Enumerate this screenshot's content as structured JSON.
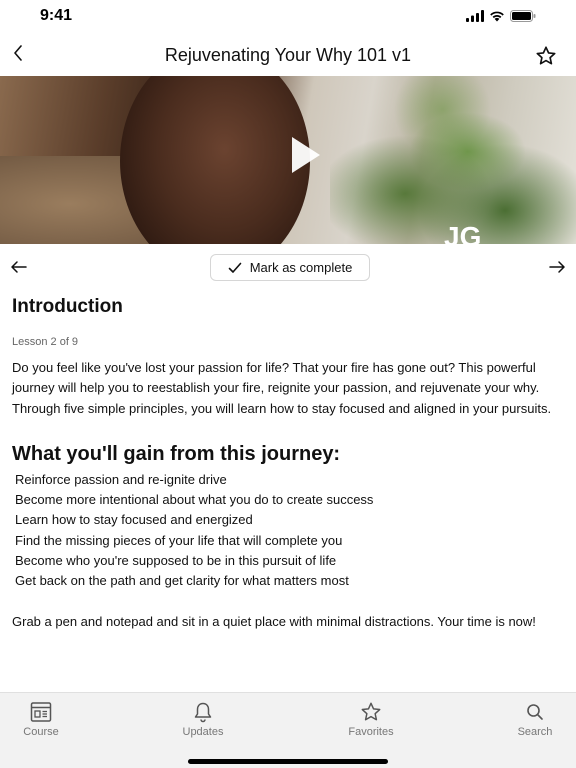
{
  "status_bar": {
    "time": "9:41"
  },
  "nav": {
    "title": "Rejuvenating Your Why 101 v1",
    "back_icon": "chevron-left-icon",
    "favorite_icon": "star-outline-icon"
  },
  "hero": {
    "logo_text": "JG",
    "play_icon": "play-icon"
  },
  "lesson_nav": {
    "mark_complete_label": "Mark as complete",
    "prev_icon": "arrow-left-icon",
    "next_icon": "arrow-right-icon"
  },
  "content": {
    "section_title": "Introduction",
    "lesson_count": "Lesson 2 of 9",
    "intro": "Do you feel like you've lost your passion for life? That your fire has gone out? This powerful journey will help you to reestablish your fire, reignite your passion, and rejuvenate your why. Through five simple principles, you will learn how to stay focused and aligned in your pursuits.",
    "gain_heading": "What you'll gain from this journey:",
    "gains": [
      "Reinforce passion and re-ignite drive",
      "Become more intentional about what you do to create success",
      "Learn how to stay focused and energized",
      "Find the missing pieces of your life that will complete you",
      "Become who you're supposed to be in this pursuit of life",
      "Get back on the path and get clarity for what matters most"
    ],
    "closing": "Grab a pen and notepad and sit in a quiet place with minimal distractions. Your time is now!"
  },
  "tab_bar": {
    "tabs": [
      {
        "label": "Course",
        "icon": "course-icon"
      },
      {
        "label": "Updates",
        "icon": "bell-icon"
      },
      {
        "label": "Favorites",
        "icon": "star-icon"
      },
      {
        "label": "Search",
        "icon": "search-icon"
      }
    ]
  },
  "colors": {
    "text": "#111111",
    "muted": "#777777",
    "tab_bar_bg": "#f2f2f2",
    "border": "#d6d6d6"
  }
}
